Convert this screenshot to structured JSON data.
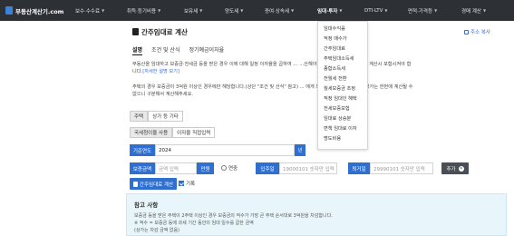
{
  "nav": {
    "logo": "부동산계산기.com",
    "items": [
      {
        "label": "보수·수수료",
        "active": false
      },
      {
        "label": "취득·등기비용",
        "active": false
      },
      {
        "label": "보유세",
        "active": false
      },
      {
        "label": "양도세",
        "active": false
      },
      {
        "label": "증여·상속세",
        "active": false
      },
      {
        "label": "임대·투자",
        "active": true
      },
      {
        "label": "DTI·LTV",
        "active": false
      },
      {
        "label": "면적·가격등",
        "active": false
      },
      {
        "label": "경매 계산",
        "active": false
      }
    ]
  },
  "dropdown": {
    "items": [
      "임대수익률",
      "적정 매수가",
      "간주임대료",
      "주택임대소득세",
      "종합소득세",
      "전월세 전환",
      "월세보증금 조정",
      "적정 임대인 혜택",
      "전세보증보험",
      "임대료 상승분",
      "면책 임대료 이자",
      "명도비용"
    ]
  },
  "page": {
    "title": "간주임대료 계산",
    "copy_link": "주소 복사",
    "subtabs": [
      "설명",
      "조건 및 산식",
      "정기예금이자율"
    ],
    "desc_line1": "부동산을 임대하고 보증금·전세금 등을 받은 경우 이에 대해 일정 이자율을 곱하여 ...",
    "desc_line1_end": "...산해야 합니다. 이 수입은 소득세 계산시 포함시켜야 합",
    "desc_line2_prefix": "니다.",
    "desc_link": "[자세한 설명 보기]",
    "desc2_line1": "주택의 경우 보증금이 3억원 이상인 경우에만 해당합니다.(상단 \"조건 및 산식\" 참고) ... 에게 모두 포함합니다. 주택과 상가는 한번에 계산될 수",
    "desc2_line2": "없으니 구분해서 계산해주세요."
  },
  "form": {
    "property_tabs": [
      "주택",
      "상가 등 기타"
    ],
    "rate_tabs": [
      "국세청이율 사용",
      "이자율 직접입력"
    ],
    "year_label": "기준연도",
    "year_value": "2024",
    "year_btn": "년",
    "deposit_label": "보증금액",
    "deposit_placeholder": "금액 입력",
    "unit_btn": "만원",
    "radio_label": "연중",
    "move_in_label": "입주일",
    "move_in_placeholder": "19000101 숫자만 입력",
    "move_out_label": "퇴거일",
    "move_out_placeholder": "29990101 숫자만 입력",
    "add_btn": "추가",
    "calc_btn": "간주임대료 계산",
    "record_label": "기록"
  },
  "notes": {
    "title": "참고 사항",
    "line1": "보증금 등을 받은 주택이 2주택 이상인 경우 보증금의 적수가 가장 큰 주택 순서대로 3억원을 차감합니다.",
    "line2": "※ 적수 = 보증금 등에 과세 기간 동안의 임대 일수를 곱한 금액",
    "line3": "(상가는 차감 금액 없음)"
  },
  "colors": {
    "nav_bg": "#2d3035",
    "accent": "#2f6fd0",
    "notes_bg": "#e8f6fb"
  }
}
